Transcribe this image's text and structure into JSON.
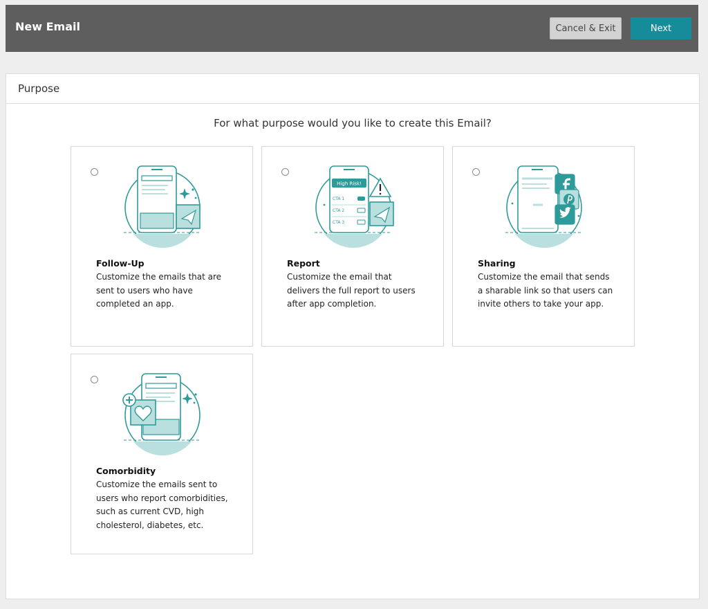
{
  "header": {
    "title": "New Email",
    "cancel_label": "Cancel & Exit",
    "next_label": "Next"
  },
  "panel": {
    "title": "Purpose",
    "question": "For what purpose would you like to create this Email?"
  },
  "colors": {
    "accent": "#168c9b",
    "header_bg": "#5e5e5e",
    "illustration_teal": "#2f9a9a"
  },
  "cards": [
    {
      "icon": "send-message-icon",
      "title": "Follow-Up",
      "description": "Customize the emails that are sent to users who have completed an app."
    },
    {
      "icon": "report-alert-icon",
      "title": "Report",
      "description": "Customize the email that delivers the full report to users after app completion.",
      "illustration": {
        "badge": "High Risk!",
        "cta_1": "CTA 1",
        "cta_2": "CTA 2",
        "cta_3": "CTA 3"
      }
    },
    {
      "icon": "social-share-icon",
      "title": "Sharing",
      "description": "Customize the email that sends a sharable link so that users can invite others to take your app."
    },
    {
      "icon": "heart-plus-icon",
      "title": "Comorbidity",
      "description": "Customize the emails sent to users who report comorbidities, such as current CVD, high cholesterol, diabetes, etc."
    }
  ]
}
